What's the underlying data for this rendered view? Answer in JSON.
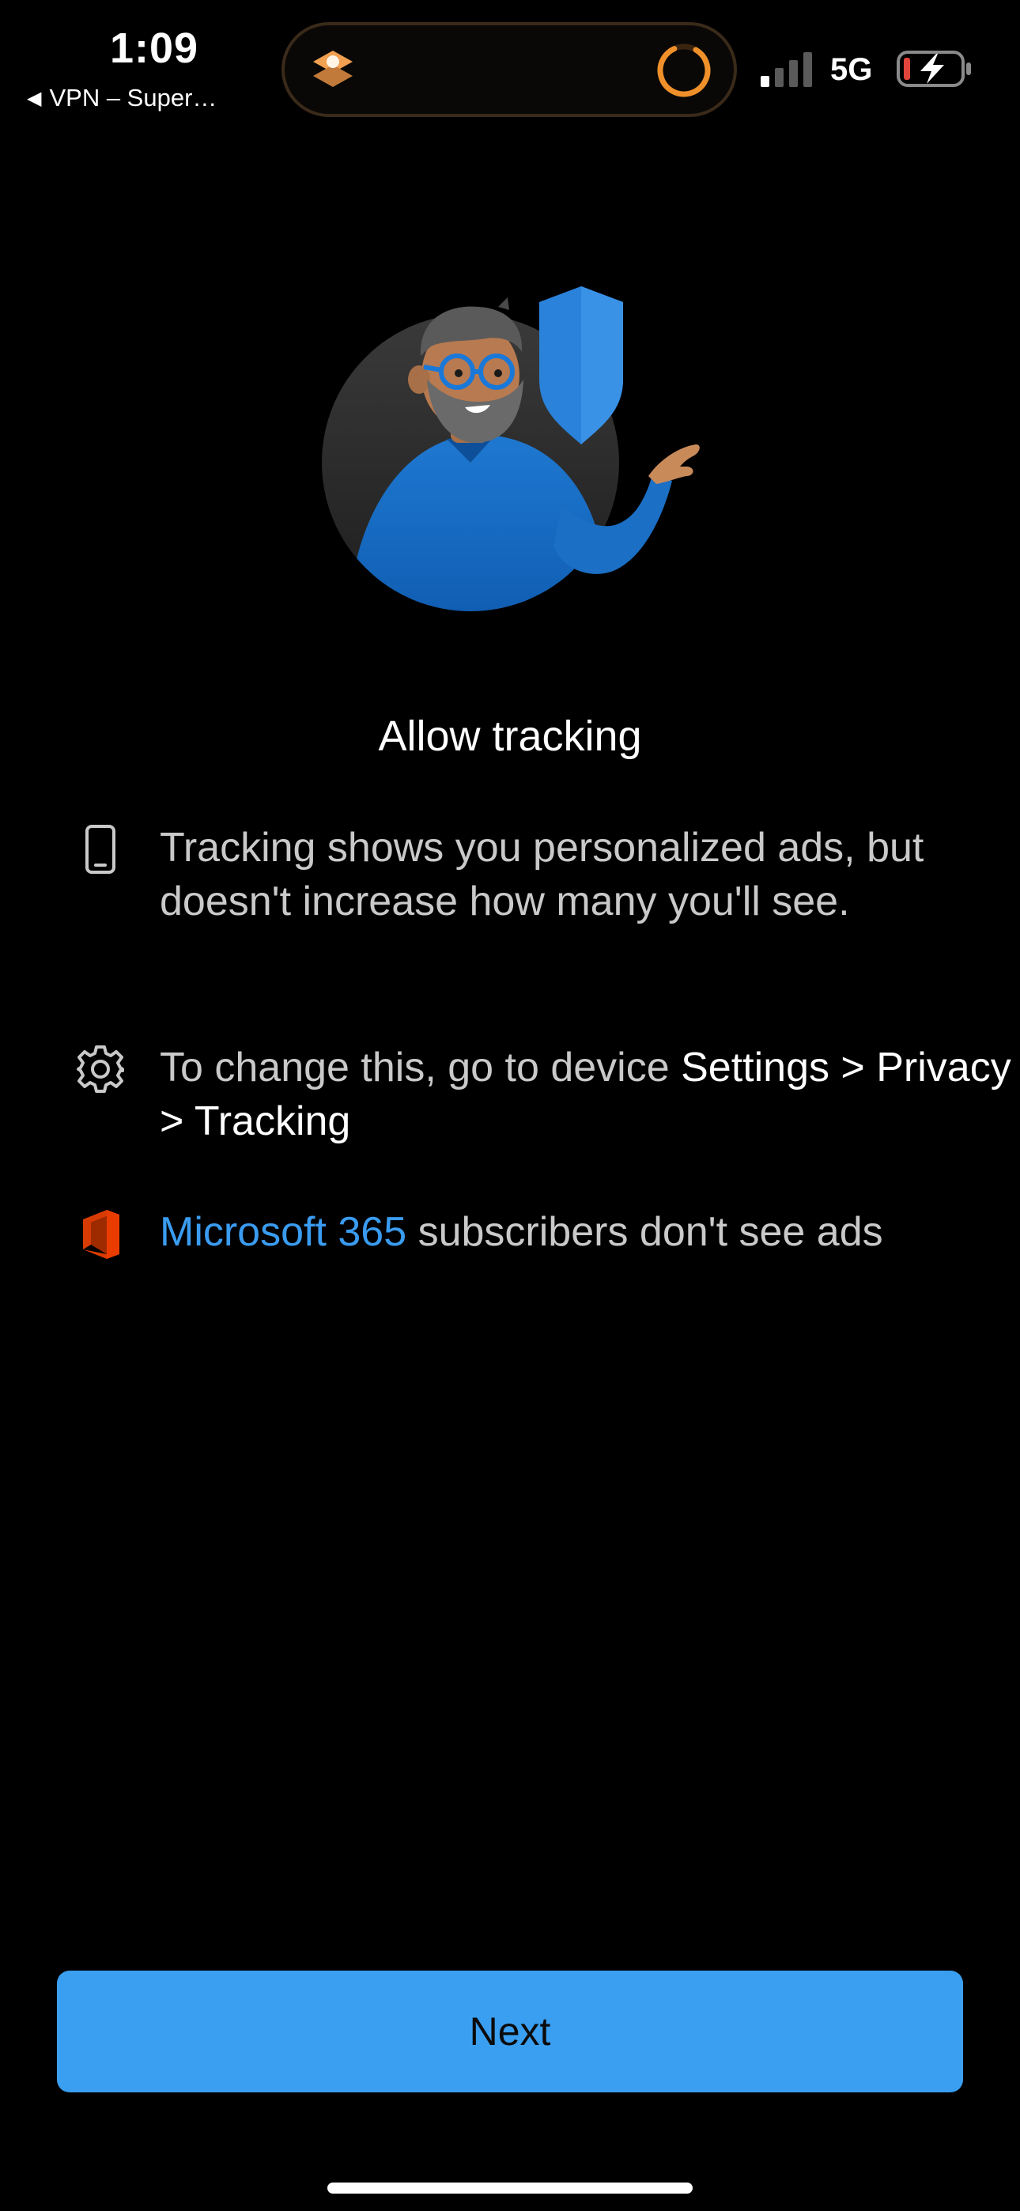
{
  "status_bar": {
    "time": "1:09",
    "back_app_label": "VPN – Super…",
    "network": "5G",
    "colors": {
      "accent_ring": "#f0902a",
      "battery_low": "#e0443a"
    }
  },
  "main": {
    "title": "Allow tracking",
    "rows": [
      {
        "icon": "phone-icon",
        "text": "Tracking shows you personalized ads, but doesn't increase how many you'll see."
      },
      {
        "icon": "gear-icon",
        "text_plain": "To change this, go to device ",
        "text_highlight": "Settings > Privacy > Tracking"
      },
      {
        "icon": "office-logo-icon",
        "text_link": "Microsoft 365",
        "text_plain": " subscribers don't see ads"
      }
    ]
  },
  "footer": {
    "next_label": "Next"
  },
  "colors": {
    "background": "#000000",
    "primary_button": "#3a9ff0",
    "link": "#3a9cf0",
    "secondary_text": "#c9c9c9"
  }
}
